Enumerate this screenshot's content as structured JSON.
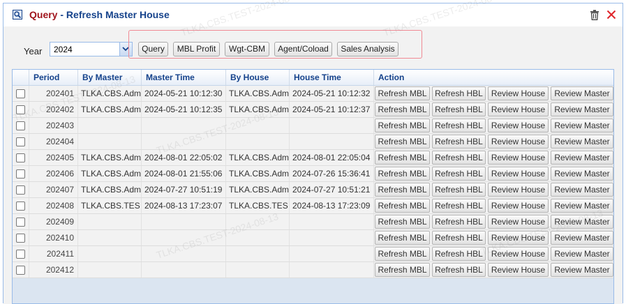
{
  "window": {
    "title_part1": "Query",
    "title_sep": " - ",
    "title_part2": "Refresh Master House",
    "accent_color": "#15428b",
    "title_red": "#a0141c",
    "close_color": "#e0252b"
  },
  "filters": {
    "year_label": "Year",
    "year_value": "2024"
  },
  "toolbar": {
    "query_label": "Query",
    "mbl_profit_label": "MBL Profit",
    "wgt_cbm_label": "Wgt-CBM",
    "agent_coload_label": "Agent/Coload",
    "sales_analysis_label": "Sales Analysis"
  },
  "grid": {
    "columns": {
      "period": "Period",
      "by_master": "By Master",
      "master_time": "Master Time",
      "by_house": "By House",
      "house_time": "House Time",
      "action": "Action"
    },
    "actions": {
      "refresh_mbl": "Refresh MBL",
      "refresh_hbl": "Refresh HBL",
      "review_house": "Review House",
      "review_master": "Review Master"
    },
    "rows": [
      {
        "period": "202401",
        "by_master": "TLKA.CBS.Adm",
        "master_time": "2024-05-21 10:12:30",
        "by_house": "TLKA.CBS.Adm",
        "house_time": "2024-05-21 10:12:32"
      },
      {
        "period": "202402",
        "by_master": "TLKA.CBS.Adm",
        "master_time": "2024-05-21 10:12:35",
        "by_house": "TLKA.CBS.Adm",
        "house_time": "2024-05-21 10:12:37"
      },
      {
        "period": "202403",
        "by_master": "",
        "master_time": "",
        "by_house": "",
        "house_time": ""
      },
      {
        "period": "202404",
        "by_master": "",
        "master_time": "",
        "by_house": "",
        "house_time": ""
      },
      {
        "period": "202405",
        "by_master": "TLKA.CBS.Adm",
        "master_time": "2024-08-01 22:05:02",
        "by_house": "TLKA.CBS.Adm",
        "house_time": "2024-08-01 22:05:04"
      },
      {
        "period": "202406",
        "by_master": "TLKA.CBS.Adm",
        "master_time": "2024-08-01 21:55:06",
        "by_house": "TLKA.CBS.Adm",
        "house_time": "2024-07-26 15:36:41"
      },
      {
        "period": "202407",
        "by_master": "TLKA.CBS.Adm",
        "master_time": "2024-07-27 10:51:19",
        "by_house": "TLKA.CBS.Adm",
        "house_time": "2024-07-27 10:51:21"
      },
      {
        "period": "202408",
        "by_master": "TLKA.CBS.TES",
        "master_time": "2024-08-13 17:23:07",
        "by_house": "TLKA.CBS.TES",
        "house_time": "2024-08-13 17:23:09"
      },
      {
        "period": "202409",
        "by_master": "",
        "master_time": "",
        "by_house": "",
        "house_time": ""
      },
      {
        "period": "202410",
        "by_master": "",
        "master_time": "",
        "by_house": "",
        "house_time": ""
      },
      {
        "period": "202411",
        "by_master": "",
        "master_time": "",
        "by_house": "",
        "house_time": ""
      },
      {
        "period": "202412",
        "by_master": "",
        "master_time": "",
        "by_house": "",
        "house_time": ""
      }
    ]
  },
  "watermark": "TLKA.CBS.TEST-2024-08-13"
}
